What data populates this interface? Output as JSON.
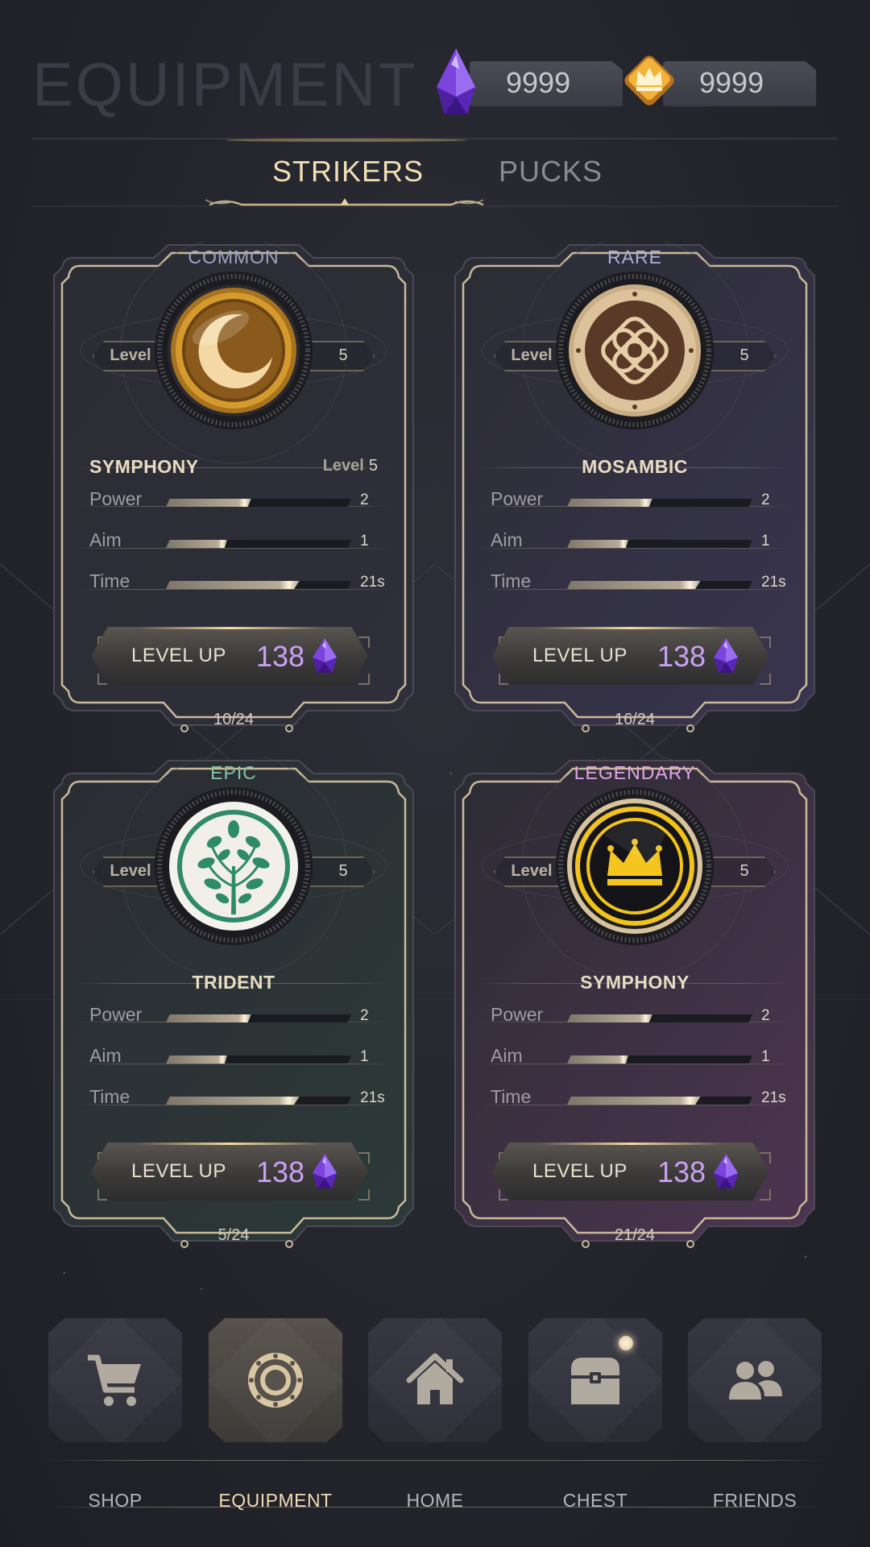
{
  "header": {
    "title": "EQUIPMENT",
    "gems": "9999",
    "crowns": "9999"
  },
  "tabs": [
    {
      "label": "STRIKERS",
      "active": true
    },
    {
      "label": "PUCKS",
      "active": false
    }
  ],
  "cards": [
    {
      "rarity": "COMMON",
      "rarity_color": "#9fa6c6",
      "level_label": "Level",
      "level": "5",
      "name": "SYMPHONY",
      "name_level_label": "Level",
      "name_level": "5",
      "coin": "moon-coin-icon",
      "stats": [
        {
          "label": "Power",
          "value": "2",
          "fill": 0.46
        },
        {
          "label": "Aim",
          "value": "1",
          "fill": 0.33
        },
        {
          "label": "Time",
          "value": "21s",
          "fill": 0.72
        }
      ],
      "button_label": "LEVEL UP",
      "cost": "138",
      "progress": "10/24"
    },
    {
      "rarity": "RARE",
      "rarity_color": "#aab0e0",
      "level_label": "Level",
      "level": "5",
      "name": "MOSAMBIC",
      "coin": "knot-coin-icon",
      "stats": [
        {
          "label": "Power",
          "value": "2",
          "fill": 0.46
        },
        {
          "label": "Aim",
          "value": "1",
          "fill": 0.33
        },
        {
          "label": "Time",
          "value": "21s",
          "fill": 0.72
        }
      ],
      "button_label": "LEVEL UP",
      "cost": "138",
      "progress": "16/24"
    },
    {
      "rarity": "EPIC",
      "rarity_color": "#86c2a6",
      "level_label": "Level",
      "level": "5",
      "name": "TRIDENT",
      "coin": "tree-coin-icon",
      "stats": [
        {
          "label": "Power",
          "value": "2",
          "fill": 0.46
        },
        {
          "label": "Aim",
          "value": "1",
          "fill": 0.33
        },
        {
          "label": "Time",
          "value": "21s",
          "fill": 0.72
        }
      ],
      "button_label": "LEVEL UP",
      "cost": "138",
      "progress": "5/24"
    },
    {
      "rarity": "LEGENDARY",
      "rarity_color": "#e2a6e4",
      "level_label": "Level",
      "level": "5",
      "name": "SYMPHONY",
      "coin": "crown-coin-icon",
      "stats": [
        {
          "label": "Power",
          "value": "2",
          "fill": 0.46
        },
        {
          "label": "Aim",
          "value": "1",
          "fill": 0.33
        },
        {
          "label": "Time",
          "value": "21s",
          "fill": 0.72
        }
      ],
      "button_label": "LEVEL UP",
      "cost": "138",
      "progress": "21/24"
    }
  ],
  "nav": [
    {
      "label": "SHOP",
      "icon": "cart-icon",
      "active": false
    },
    {
      "label": "EQUIPMENT",
      "icon": "equipment-icon",
      "active": true
    },
    {
      "label": "HOME",
      "icon": "home-icon",
      "active": false
    },
    {
      "label": "CHEST",
      "icon": "chest-icon",
      "active": false,
      "notification": true
    },
    {
      "label": "FRIENDS",
      "icon": "friends-icon",
      "active": false
    }
  ]
}
